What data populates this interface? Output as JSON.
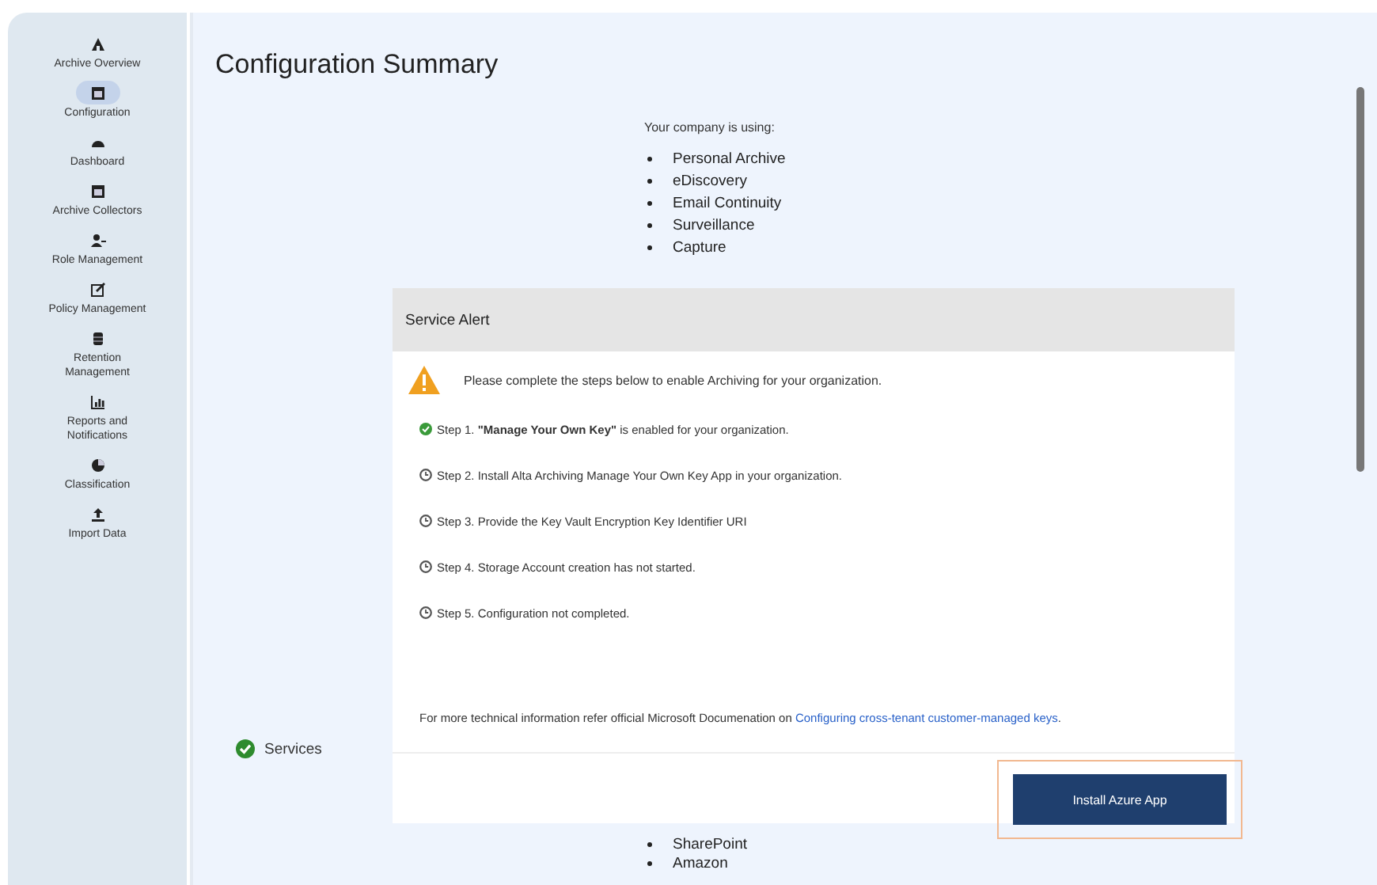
{
  "sidebar": {
    "items": [
      {
        "label": "Archive Overview",
        "selected": false
      },
      {
        "label": "Configuration",
        "selected": true
      },
      {
        "label": "Dashboard",
        "selected": false
      },
      {
        "label": "Archive Collectors",
        "selected": false
      },
      {
        "label": "Role Management",
        "selected": false
      },
      {
        "label": "Policy Management",
        "selected": false
      },
      {
        "label": "Retention Management",
        "selected": false
      },
      {
        "label": "Reports and Notifications",
        "selected": false
      },
      {
        "label": "Classification",
        "selected": false
      },
      {
        "label": "Import Data",
        "selected": false
      }
    ]
  },
  "page": {
    "title": "Configuration Summary",
    "intro": "Your company is using:",
    "products": [
      "Personal Archive",
      "eDiscovery",
      "Email Continuity",
      "Surveillance",
      "Capture"
    ],
    "services": {
      "label": "Services",
      "done": true,
      "items": [
        "SharePoint",
        "Amazon"
      ]
    }
  },
  "dialog": {
    "title": "Service Alert",
    "warning": "Please complete the steps below to enable Archiving for your organization.",
    "steps": [
      {
        "text": "Step 1. **\"Manage Your Own Key\"** is enabled for your organization.",
        "done": true
      },
      {
        "text": "Step 2. Install Alta Archiving Manage Your Own Key App in your organization.",
        "done": false
      },
      {
        "text": "Step 3. Provide the Key Vault Encryption Key Identifier URI",
        "done": false
      },
      {
        "text": "Step 4. Storage Account creation has not started.",
        "done": false
      },
      {
        "text": "Step 5. Configuration not completed.",
        "done": false
      }
    ],
    "note": "For more technical information refer official Microsoft Documenation on ",
    "link": "Configuring cross-tenant customer-managed keys",
    "note_end": ".",
    "button": "Install Azure App",
    "button_highlighted": true
  }
}
